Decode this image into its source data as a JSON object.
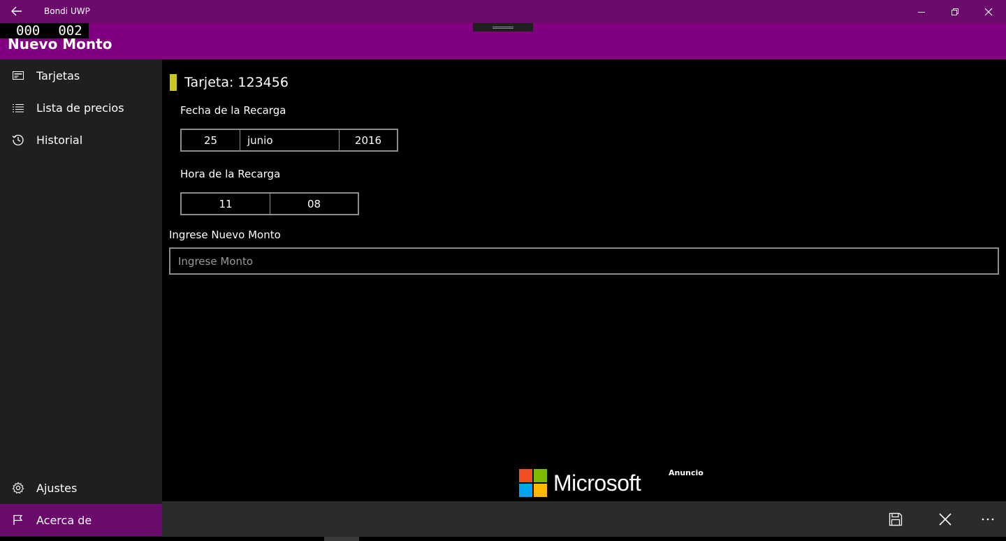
{
  "window": {
    "title": "Bondi UWP",
    "back_icon": "back-arrow-icon",
    "minimize_icon": "minimize-icon",
    "restore_icon": "restore-icon",
    "close_icon": "close-icon"
  },
  "counter": {
    "left": "000",
    "right": "002"
  },
  "header": {
    "title": "Nuevo Monto",
    "accent_color": "#800080"
  },
  "sidebar": {
    "items": [
      {
        "label": "Tarjetas",
        "icon": "card-icon"
      },
      {
        "label": "Lista de precios",
        "icon": "list-icon"
      },
      {
        "label": "Historial",
        "icon": "history-icon"
      }
    ],
    "bottom_items": [
      {
        "label": "Ajustes",
        "icon": "gear-icon"
      },
      {
        "label": "Acerca de",
        "icon": "flag-icon",
        "active": true
      }
    ]
  },
  "main": {
    "card_title": "Tarjeta: 123456",
    "card_marker_color": "#c8c820",
    "date_label": "Fecha de la Recarga",
    "date": {
      "day": "25",
      "month": "junio",
      "year": "2016"
    },
    "time_label": "Hora de la Recarga",
    "time": {
      "hour": "11",
      "minute": "08"
    },
    "amount_label": "Ingrese Nuevo Monto",
    "amount_placeholder": "Ingrese Monto",
    "amount_value": ""
  },
  "ad": {
    "brand": "Microsoft",
    "label": "Anuncio"
  },
  "command_bar": {
    "buttons": [
      {
        "icon": "save-icon"
      },
      {
        "icon": "cancel-icon"
      },
      {
        "icon": "more-icon"
      }
    ]
  }
}
